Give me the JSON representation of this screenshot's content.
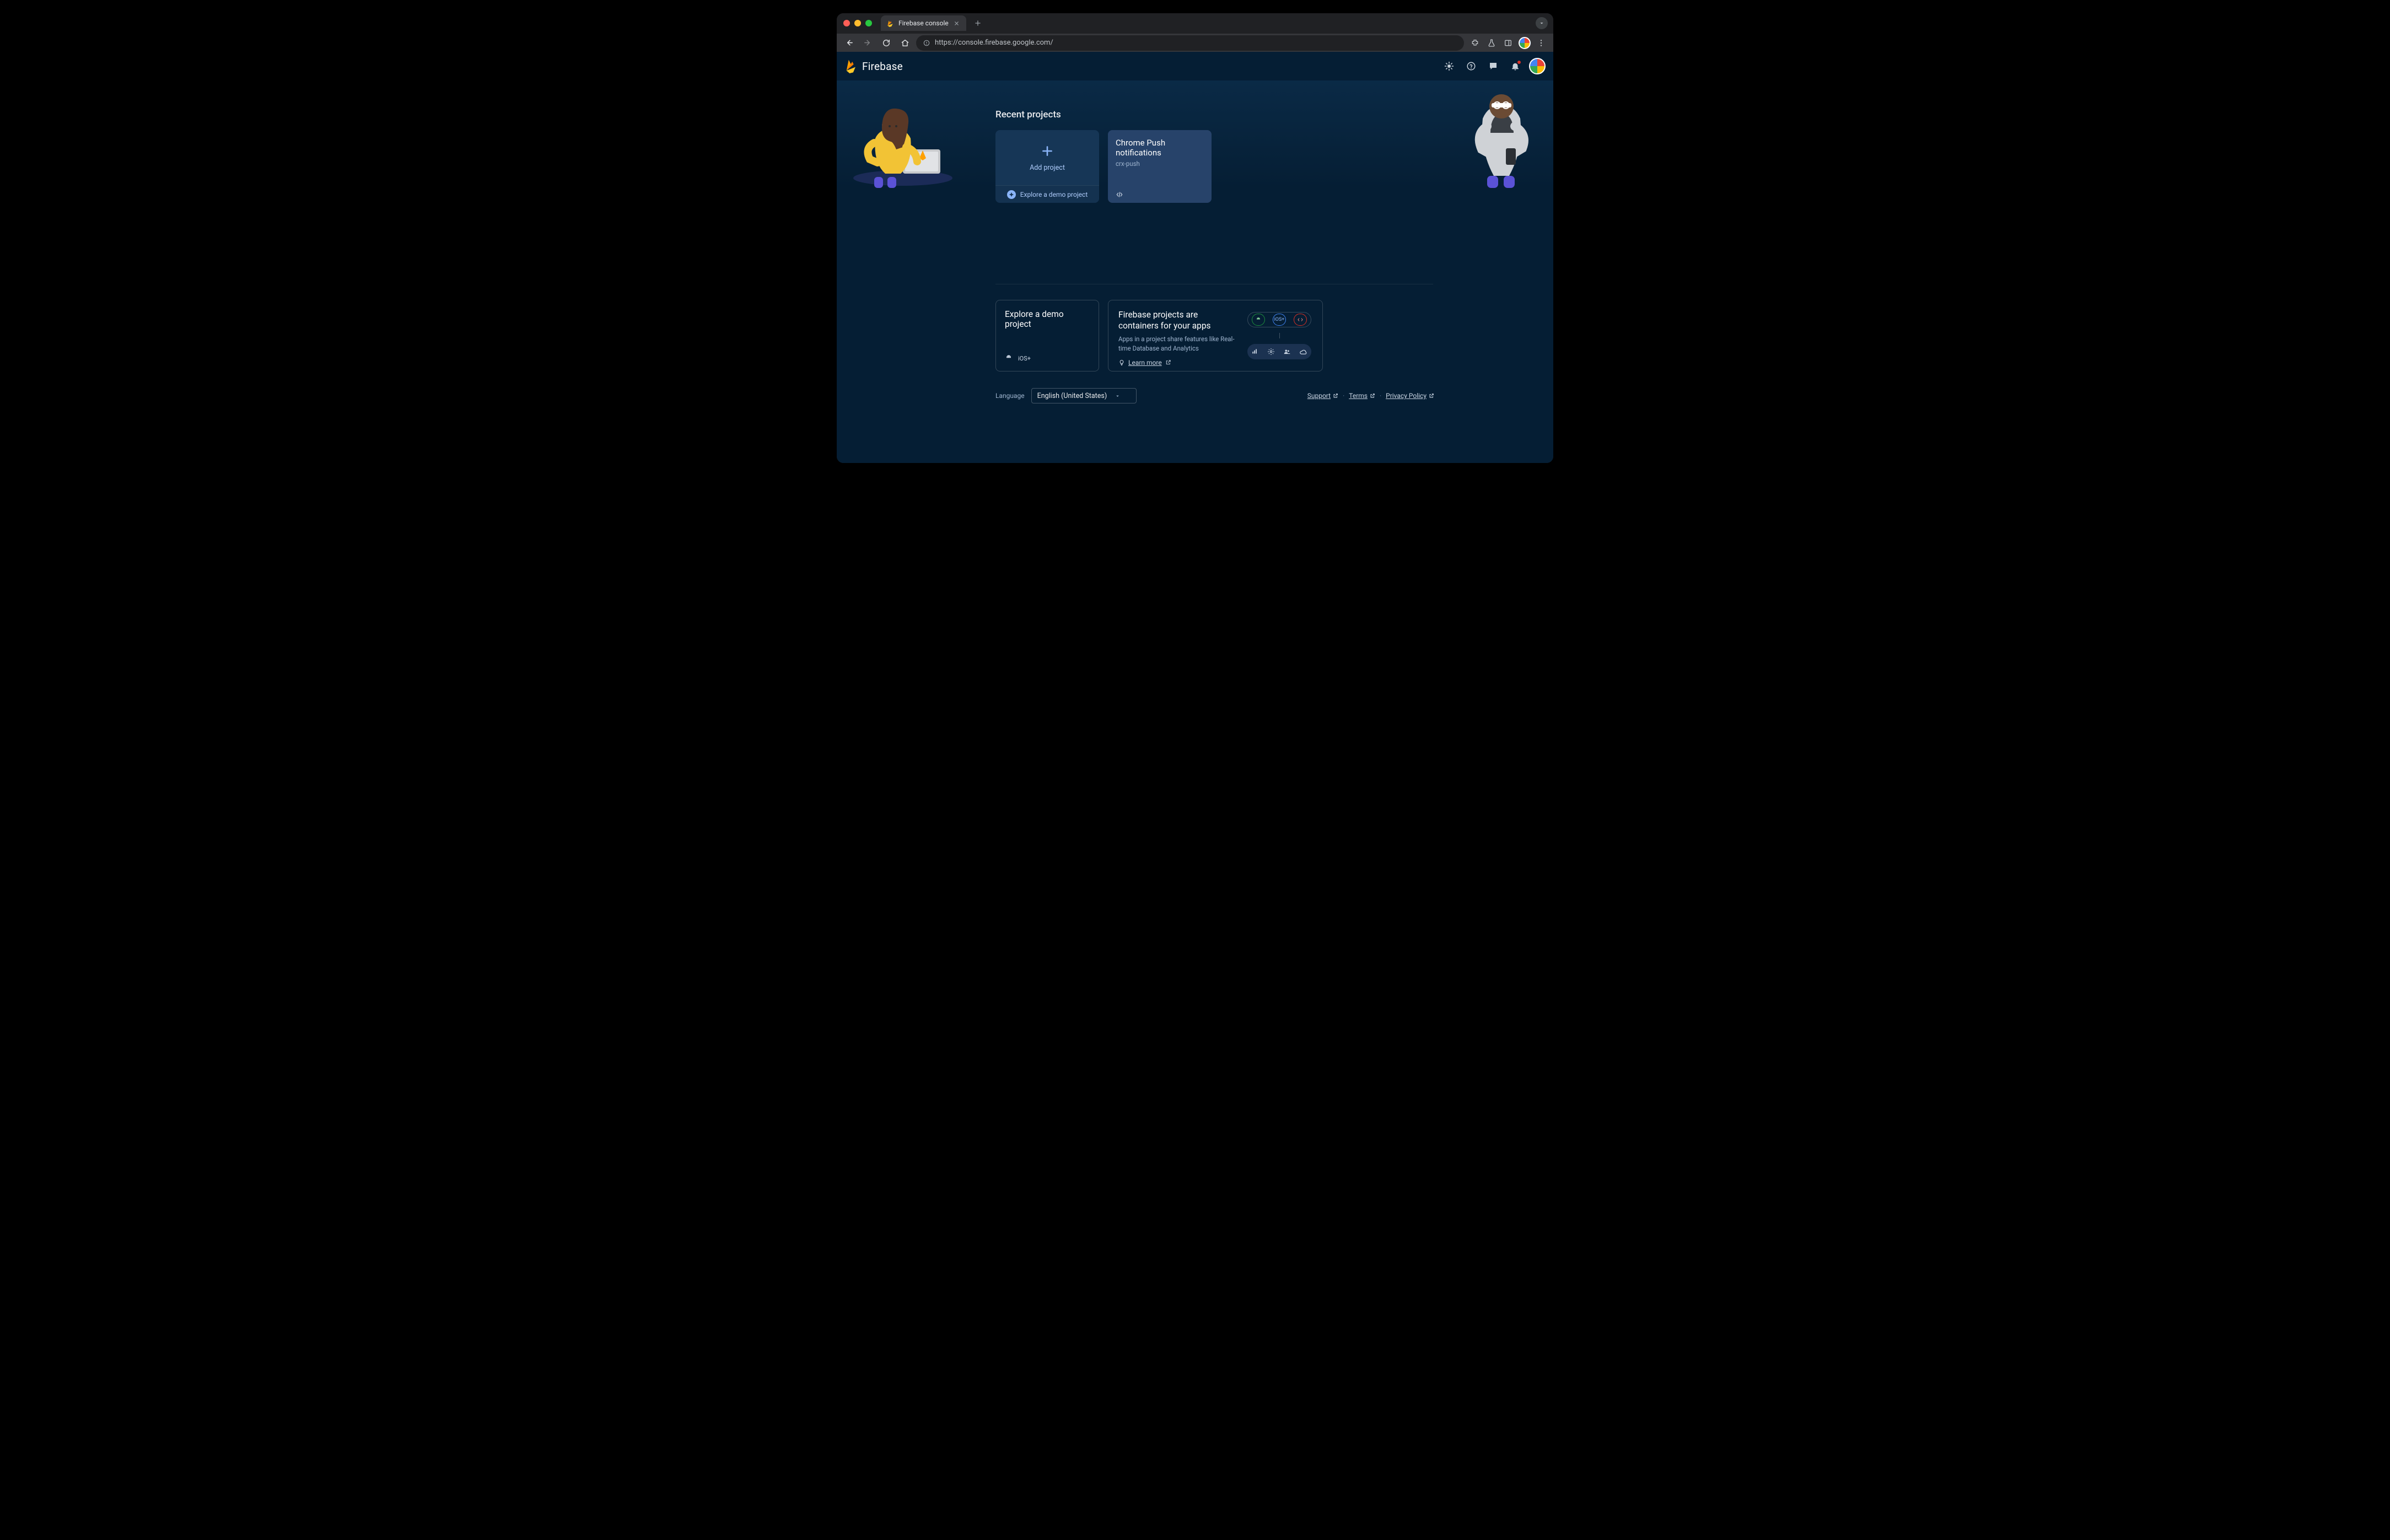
{
  "browser": {
    "tab_title": "Firebase console",
    "url": "https://console.firebase.google.com/"
  },
  "header": {
    "brand": "Firebase"
  },
  "hero": {
    "section_title": "Recent projects",
    "add_project_label": "Add project",
    "explore_demo_link": "Explore a demo project"
  },
  "projects": [
    {
      "title": "Chrome Push notifications",
      "id": "crx-push"
    }
  ],
  "lower": {
    "demo_title": "Explore a demo project",
    "containers_title": "Firebase projects are containers for your apps",
    "containers_desc": "Apps in a project share features like Real-time Database and Analytics",
    "learn_more": "Learn more",
    "ios_label": "iOS+"
  },
  "footer": {
    "language_label": "Language",
    "language_value": "English (United States)",
    "support": "Support",
    "terms": "Terms",
    "privacy": "Privacy Policy"
  }
}
